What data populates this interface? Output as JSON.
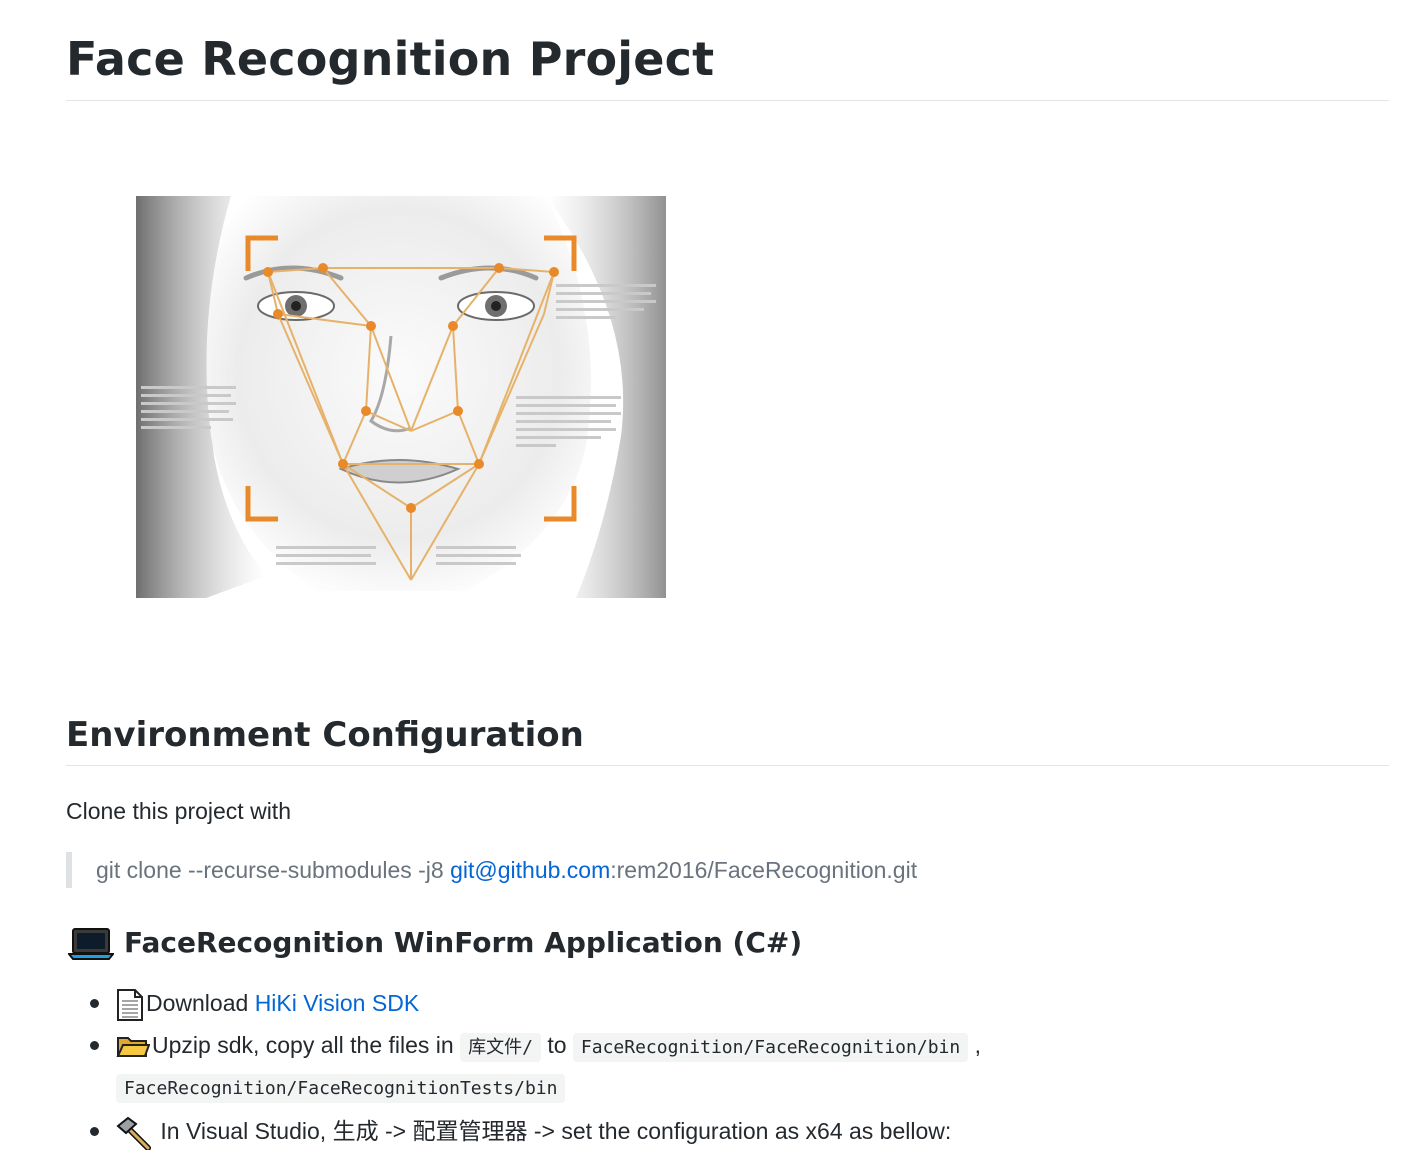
{
  "doc": {
    "title": "Face Recognition Project",
    "section_title": "Environment Configuration",
    "clone_text": "Clone this project with",
    "quote": {
      "prefix": "git clone --recurse-submodules -j8 ",
      "link": "git@github.com",
      "suffix": ":rem2016/FaceRecognition.git"
    },
    "subsection": {
      "title": "FaceRecognition WinForm Application (C#)",
      "icon": "laptop-icon"
    },
    "steps": [
      {
        "icon": "page-icon",
        "text": "Download ",
        "link": "HiKi Vision SDK"
      },
      {
        "icon": "folder-icon",
        "text_a": "Upzip sdk, copy all the files in ",
        "code_a": "库文件/",
        "text_b": " to ",
        "code_b": "FaceRecognition/FaceRecognition/bin",
        "text_c": " ,",
        "code_c": "FaceRecognition/FaceRecognitionTests/bin"
      },
      {
        "icon": "hammer-icon",
        "text": " In Visual Studio, 生成 -> 配置管理器 -> set the configuration as x64 as bellow:"
      }
    ]
  },
  "colors": {
    "text": "#24292e",
    "link": "#0366d6",
    "muted": "#6a737d",
    "landmark_orange": "#e8892a",
    "mesh_line": "#e6b26a"
  }
}
